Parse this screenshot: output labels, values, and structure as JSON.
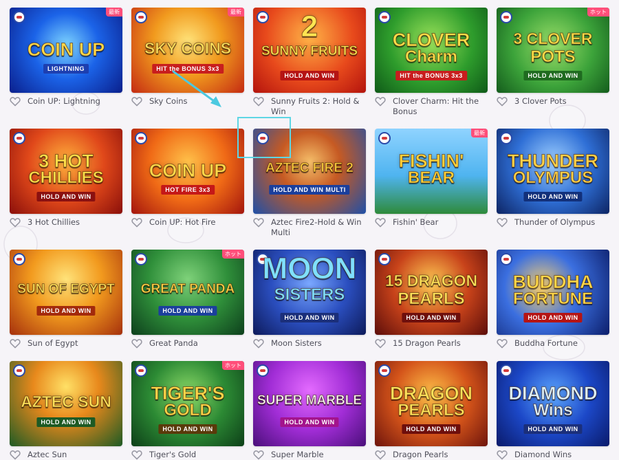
{
  "badges": {
    "new": "最新",
    "hot": "ホット"
  },
  "games": [
    {
      "name": "Coin UP: Lightning",
      "t1": "COIN UP",
      "t2": "",
      "sub": "LIGHTNING",
      "badge": "new",
      "bg": "radial-gradient(circle at 50% 45%, #7fd6ff 0%, #1b63e8 45%, #0a1f8c 100%)",
      "tc": "#ffd94a",
      "sc": "#1d3fb0"
    },
    {
      "name": "Sky Coins",
      "t1": "SKY COINS",
      "t2": "",
      "sub": "HIT the BONUS 3x3",
      "badge": "new",
      "bg": "radial-gradient(circle at 50% 40%, #ffe37a 0%, #f19a1e 45%, #c42a12 100%)",
      "tc": "#ffe15c",
      "sc": "#c81e1e"
    },
    {
      "name": "Sunny Fruits 2: Hold & Win",
      "t1": "2",
      "t2": "SUNNY FRUITS",
      "sub": "HOLD AND WIN",
      "badge": "",
      "bg": "radial-gradient(circle at 50% 35%, #ffb347 0%, #e84a1c 55%, #b3130d 100%)",
      "tc": "#ffe552",
      "sc": "#b51414"
    },
    {
      "name": "Clover Charm: Hit the Bonus",
      "t1": "CLOVER",
      "t2": "Charm",
      "sub": "HIT the BONUS 3x3",
      "badge": "",
      "bg": "radial-gradient(circle at 50% 40%, #9be25a 0%, #2e9c2c 55%, #0f5a18 100%)",
      "tc": "#ffe04a",
      "sc": "#c81e1e"
    },
    {
      "name": "3 Clover Pots",
      "t1": "3 CLOVER",
      "t2": "POTS",
      "sub": "HOLD AND WIN",
      "badge": "hot",
      "bg": "radial-gradient(circle at 50% 45%, #9ee06b 0%, #3ca33a 55%, #145c1c 100%)",
      "tc": "#ffe04a",
      "sc": "#1f6b20"
    },
    {
      "name": "3 Hot Chillies",
      "t1": "3 HOT",
      "t2": "CHILLIES",
      "sub": "HOLD AND WIN",
      "badge": "",
      "bg": "radial-gradient(circle at 50% 40%, #ffb23d 0%, #e0481a 50%, #8a0f0a 100%)",
      "tc": "#ffe14a",
      "sc": "#8a1010"
    },
    {
      "name": "Coin UP: Hot Fire",
      "t1": "COIN UP",
      "t2": "",
      "sub": "HOT FIRE 3x3",
      "badge": "",
      "bg": "radial-gradient(circle at 50% 40%, #ffc24a 0%, #f06a16 50%, #a3150d 100%)",
      "tc": "#ffd94a",
      "sc": "#c41818"
    },
    {
      "name": "Aztec Fire2-Hold & Win Multi",
      "t1": "AZTEC FIRE 2",
      "t2": "",
      "sub": "HOLD AND WIN MULTI",
      "badge": "",
      "bg": "radial-gradient(circle at 50% 40%, #f6c06a 0%, #c65a23 40%, #1e4fa8 100%)",
      "tc": "#ffd040",
      "sc": "#1b3f9c"
    },
    {
      "name": "Fishin' Bear",
      "t1": "FISHIN'",
      "t2": "BEAR",
      "sub": "",
      "badge": "new",
      "bg": "linear-gradient(180deg, #8fd3ff 0%, #4fb4f0 55%, #2e8a3a 100%)",
      "tc": "#ffd23a",
      "sc": "#1b5fa8"
    },
    {
      "name": "Thunder of Olympus",
      "t1": "THUNDER",
      "t2": "OLYMPUS",
      "sub": "HOLD AND WIN",
      "badge": "",
      "bg": "radial-gradient(circle at 50% 40%, #9fd0ff 0%, #2f6fd6 50%, #0d2463 100%)",
      "tc": "#ffd34a",
      "sc": "#12307a"
    },
    {
      "name": "Sun of Egypt",
      "t1": "SUN OF EGYPT",
      "t2": "",
      "sub": "HOLD AND WIN",
      "badge": "",
      "bg": "radial-gradient(circle at 50% 35%, #ffe37a 0%, #f29a1e 45%, #a5300c 100%)",
      "tc": "#ffe35a",
      "sc": "#a32a0c"
    },
    {
      "name": "Great Panda",
      "t1": "GREAT PANDA",
      "t2": "",
      "sub": "HOLD AND WIN",
      "badge": "hot",
      "bg": "radial-gradient(circle at 50% 35%, #7fd27a 0%, #2f8f3a 50%, #0d3f1c 100%)",
      "tc": "#ffd84a",
      "sc": "#1b3f9c"
    },
    {
      "name": "Moon Sisters",
      "t1": "MOON",
      "t2": "SISTERS",
      "sub": "HOLD AND WIN",
      "badge": "",
      "bg": "radial-gradient(circle at 50% 40%, #7aa8ff 0%, #2b4fc0 50%, #0d1a5a 100%)",
      "tc": "#7fe0ff",
      "sc": "#1b2f7a"
    },
    {
      "name": "15 Dragon Pearls",
      "t1": "15 DRAGON",
      "t2": "PEARLS",
      "sub": "HOLD AND WIN",
      "badge": "",
      "bg": "radial-gradient(circle at 50% 40%, #ffcc55 0%, #c8431a 50%, #5c0d0a 100%)",
      "tc": "#ffe35a",
      "sc": "#6e0f0c"
    },
    {
      "name": "Buddha Fortune",
      "t1": "BUDDHA",
      "t2": "FORTUNE",
      "sub": "HOLD AND WIN",
      "badge": "",
      "bg": "radial-gradient(circle at 40% 45%, #ffd36b 0%, #3b6fe0 45%, #0c1e6a 100%)",
      "tc": "#ffd94a",
      "sc": "#b51414"
    },
    {
      "name": "Aztec Sun",
      "t1": "AZTEC SUN",
      "t2": "",
      "sub": "HOLD AND WIN",
      "badge": "",
      "bg": "radial-gradient(circle at 50% 30%, #ffe066 0%, #e8891c 40%, #1d5a24 100%)",
      "tc": "#ffe35a",
      "sc": "#1d5a24"
    },
    {
      "name": "Tiger's Gold",
      "t1": "TIGER'S",
      "t2": "GOLD",
      "sub": "HOLD AND WIN",
      "badge": "hot",
      "bg": "radial-gradient(circle at 50% 40%, #8fdc6a 0%, #2c8a34 50%, #0d3f18 100%)",
      "tc": "#ffd84a",
      "sc": "#5a3a0a"
    },
    {
      "name": "Super Marble",
      "t1": "SUPER MARBLE",
      "t2": "",
      "sub": "HOLD AND WIN",
      "badge": "",
      "bg": "radial-gradient(circle at 50% 35%, #e46bff 0%, #a12dd6 50%, #4a0f7a 100%)",
      "tc": "#ffffff",
      "sc": "#a3148c"
    },
    {
      "name": "Dragon Pearls",
      "t1": "DRAGON",
      "t2": "PEARLS",
      "sub": "HOLD AND WIN",
      "badge": "",
      "bg": "radial-gradient(circle at 50% 40%, #ffc34a 0%, #d4541a 50%, #6e140c 100%)",
      "tc": "#ffe35a",
      "sc": "#6e0f0c"
    },
    {
      "name": "Diamond Wins",
      "t1": "DIAMOND",
      "t2": "Wins",
      "sub": "HOLD AND WIN",
      "badge": "",
      "bg": "radial-gradient(circle at 50% 40%, #5ea8ff 0%, #1c48c8 50%, #0a1a6a 100%)",
      "tc": "#dff4ff",
      "sc": "#1b2f7a"
    }
  ]
}
